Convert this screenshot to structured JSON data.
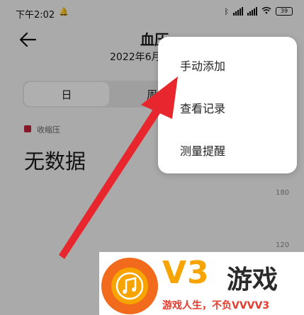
{
  "status_bar": {
    "time": "下午2:02",
    "battery": "39"
  },
  "header": {
    "title": "血压",
    "date": "2022年6月"
  },
  "tabs": {
    "day": "日",
    "week": "周"
  },
  "legend": {
    "label": "收缩压",
    "color": "#c0223a"
  },
  "empty_state": "无数据",
  "axis_ticks": [
    "180",
    "120"
  ],
  "menu": {
    "items": [
      "手动添加",
      "查看记录",
      "测量提醒"
    ]
  },
  "annotation": {
    "color": "#e8262d"
  },
  "watermark": {
    "logo_text": "V3",
    "name": "游戏",
    "slogan": "游戏人生，不负VVVV3"
  },
  "icons": {
    "back": "back-arrow-icon",
    "bell": "notification-bell-icon",
    "bluetooth": "bluetooth-icon",
    "wifi": "wifi-icon"
  }
}
